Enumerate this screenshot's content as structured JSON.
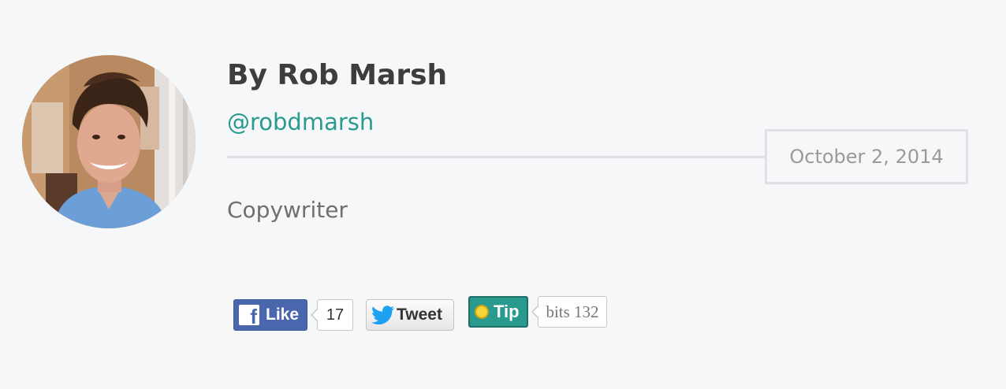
{
  "author": {
    "name": "By Rob Marsh",
    "handle": "@robdmarsh",
    "role": "Copywriter"
  },
  "post": {
    "date": "October 2, 2014"
  },
  "share": {
    "facebook": {
      "label": "Like",
      "count": "17",
      "icon": "facebook-icon",
      "color": "#4a67ad"
    },
    "twitter": {
      "label": "Tweet",
      "icon": "twitter-bird-icon",
      "color": "#1da1f2"
    },
    "tip": {
      "label": "Tip",
      "count": "bits 132",
      "icon": "coin-icon",
      "color": "#2a9a8e"
    }
  },
  "colors": {
    "background": "#f6f7f9",
    "accent": "#2a9a8e",
    "name": "#3d3d3d",
    "divider": "#dfe1e4",
    "date": "#9a9a9a"
  }
}
